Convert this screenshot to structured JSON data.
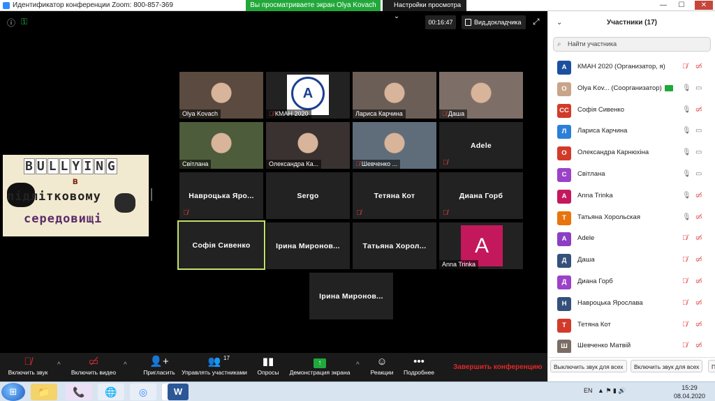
{
  "window": {
    "title": "Идентификатор конференции Zoom: 800-857-369",
    "share_banner": "Вы просматриваете экран Olya Kovach",
    "view_options": "Настройки просмотра",
    "btn_min": "—",
    "btn_max": "☐",
    "btn_close": "✕"
  },
  "meeting": {
    "timer": "00:16:47",
    "docs_label": "Вид,докладчика",
    "info_icon": "ⓘ",
    "lock_icon": "🔒",
    "fullscreen_icon": "⤢"
  },
  "shared_slide": {
    "line1": [
      "B",
      "U",
      "L",
      "L",
      "Y",
      "I",
      "N",
      "G"
    ],
    "line2": "в",
    "line3": "підлітковому",
    "line4": "середовищі"
  },
  "tiles": [
    {
      "label": "Olya Kovach",
      "muted": false,
      "kind": "photo",
      "bg": "#5a4a3f"
    },
    {
      "label": "КМАН 2020",
      "muted": true,
      "kind": "logo",
      "bg": "#222"
    },
    {
      "label": "Лариса Карчина",
      "muted": false,
      "kind": "photo",
      "bg": "#6b5e57"
    },
    {
      "label": "Даша",
      "muted": true,
      "kind": "photo",
      "bg": "#7d6f68"
    },
    {
      "label": "Світлана",
      "muted": false,
      "kind": "photo",
      "bg": "#4d5c3a"
    },
    {
      "label": "Олександра Ка...",
      "muted": false,
      "kind": "photo",
      "bg": "#3a3230"
    },
    {
      "label": "Шевченко ...",
      "muted": true,
      "kind": "photo",
      "bg": "#5f6d7a"
    },
    {
      "label": "Adele",
      "muted": true,
      "kind": "name"
    },
    {
      "label": "Навроцька Яро...",
      "muted": true,
      "kind": "name"
    },
    {
      "label": "Sergo",
      "muted": false,
      "kind": "name"
    },
    {
      "label": "Тетяна Кот",
      "muted": true,
      "kind": "name"
    },
    {
      "label": "Диана Горб",
      "muted": true,
      "kind": "name"
    },
    {
      "label": "Софія Сивенко",
      "muted": false,
      "kind": "name",
      "active": true
    },
    {
      "label": "Ірина Миронов...",
      "muted": false,
      "kind": "name"
    },
    {
      "label": "Татьяна Хорол...",
      "muted": false,
      "kind": "name"
    },
    {
      "label": "Anna Trinka",
      "muted": false,
      "kind": "avatar",
      "letter": "A"
    },
    {
      "label": "Ірина Миронов...",
      "muted": false,
      "kind": "name"
    }
  ],
  "toolbar": {
    "unmute": "Включить звук",
    "start_video": "Включить видео",
    "invite": "Пригласить",
    "manage": "Управлять участниками",
    "participant_count": "17",
    "polls": "Опросы",
    "share": "Демонстрация экрана",
    "reactions": "Реакции",
    "more": "Подробнее",
    "end": "Завершить конференцию",
    "caret": "^"
  },
  "participants": {
    "title": "Участники (17)",
    "search_placeholder": "Найти участника",
    "list": [
      {
        "initials": "A",
        "color": "#1d4fa0",
        "name": "КМАН 2020 (Организатор, я)",
        "mic": "muted",
        "cam": "off"
      },
      {
        "initials": "O",
        "color": "#c9a48a",
        "name": "Olya Kov...  (Соорганизатор)",
        "mic": "on",
        "cam": "on",
        "sharing": true
      },
      {
        "initials": "СС",
        "color": "#d23a2a",
        "name": "Софія Сивенко",
        "mic": "on",
        "cam": "off"
      },
      {
        "initials": "Л",
        "color": "#2b7fd9",
        "name": "Лариса Карчина",
        "mic": "on",
        "cam": "on"
      },
      {
        "initials": "О",
        "color": "#d23a2a",
        "name": "Олександра Карнюхіна",
        "mic": "on",
        "cam": "on"
      },
      {
        "initials": "С",
        "color": "#9b42c8",
        "name": "Світлана",
        "mic": "on",
        "cam": "on"
      },
      {
        "initials": "A",
        "color": "#c4185c",
        "name": "Anna Trinka",
        "mic": "on",
        "cam": "off"
      },
      {
        "initials": "Т",
        "color": "#e8740e",
        "name": "Татьяна Хорольская",
        "mic": "on",
        "cam": "off"
      },
      {
        "initials": "A",
        "color": "#8a3fc4",
        "name": "Adele",
        "mic": "muted",
        "cam": "off"
      },
      {
        "initials": "Д",
        "color": "#35507a",
        "name": "Даша",
        "mic": "muted",
        "cam": "off"
      },
      {
        "initials": "Д",
        "color": "#9b42c8",
        "name": "Диана Горб",
        "mic": "muted",
        "cam": "off"
      },
      {
        "initials": "Н",
        "color": "#35507a",
        "name": "Навроцька Ярослава",
        "mic": "muted",
        "cam": "off"
      },
      {
        "initials": "Т",
        "color": "#d23a2a",
        "name": "Тетяна Кот",
        "mic": "muted",
        "cam": "off"
      },
      {
        "initials": "Ш",
        "color": "#7a6d66",
        "name": "Шевченко Матвій",
        "mic": "muted",
        "cam": "off"
      }
    ],
    "btn_mute_all": "Выключить звук для всех",
    "btn_unmute_all": "Включить звук для всех",
    "btn_more": "П"
  },
  "taskbar": {
    "start_glyph": "⊞",
    "apps": [
      "📁",
      "📞",
      "🌐",
      "◎",
      "Zoom",
      "W"
    ],
    "lang": "EN",
    "time": "15:29",
    "date": "08.04.2020"
  },
  "colors": {
    "accent_green": "#1fa83c",
    "end_red": "#e02828",
    "active_border": "#c4e36b"
  }
}
